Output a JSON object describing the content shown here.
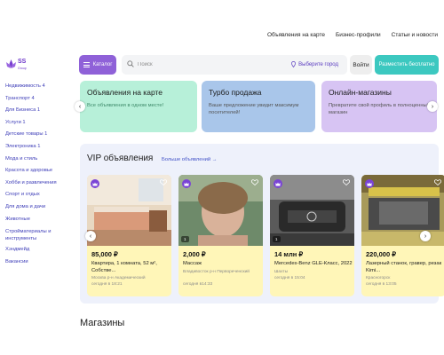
{
  "topnav": {
    "items": [
      "Объявления на карте",
      "Бизнес-профили",
      "Статьи и новости"
    ]
  },
  "logo": {
    "text": "SS",
    "sub": "Group"
  },
  "header": {
    "catalog_label": "Каталог",
    "search_placeholder": "Поиск",
    "city_label": "Выберите город",
    "find_label": "Войти",
    "post_label": "Разместить бесплатно"
  },
  "sidebar": {
    "items": [
      "Недвижимость 4",
      "Транспорт 4",
      "Для Бизнеса 1",
      "Услуги 1",
      "Детские товары 1",
      "Электроника 1",
      "Мода и стиль",
      "Красота и здоровье",
      "Хобби и развлечения",
      "Спорт и отдых",
      "Для дома и дачи",
      "Животные",
      "Стройматериалы и инструменты",
      "Хэндмейд",
      "Вакансии"
    ]
  },
  "promos": [
    {
      "title": "Объявления на карте",
      "desc": "Все объявления в одном месте!"
    },
    {
      "title": "Турбо продажа",
      "desc": "Ваше предложение увидит максимум посетителей!"
    },
    {
      "title": "Онлайн-магазины",
      "desc": "Превратите свой профиль в полноценный магазин"
    }
  ],
  "vip": {
    "title": "VIP объявления",
    "more": "Больше объявлений →",
    "cards": [
      {
        "price": "85,000 ₽",
        "title": "Квартира, 1 комната, 52 м², Собстве...",
        "location": "Москва р-н Академический",
        "date": "сегодня в 18:21",
        "photos": ""
      },
      {
        "price": "2,000 ₽",
        "title": "Массаж",
        "location": "Владивосток р-н Первореченский",
        "date": "сегодня в14:33",
        "photos": "1"
      },
      {
        "price": "14 млн ₽",
        "title": "Mercedes-Benz GLE-Класс, 2022",
        "location": "Шахты",
        "date": "сегодня в 15:04",
        "photos": "1"
      },
      {
        "price": "220,000 ₽",
        "title": "Лазерный станок, гравер, резак Kimi...",
        "location": "Красногорск",
        "date": "сегодня в 13:05",
        "photos": ""
      }
    ]
  },
  "shops_title": "Магазины",
  "colors": {
    "accent": "#8f61d8",
    "post_button": "#3cc8c0",
    "link": "#3d3db8",
    "vip_bg": "#eef1fb",
    "card_bg": "#fff6b8"
  }
}
